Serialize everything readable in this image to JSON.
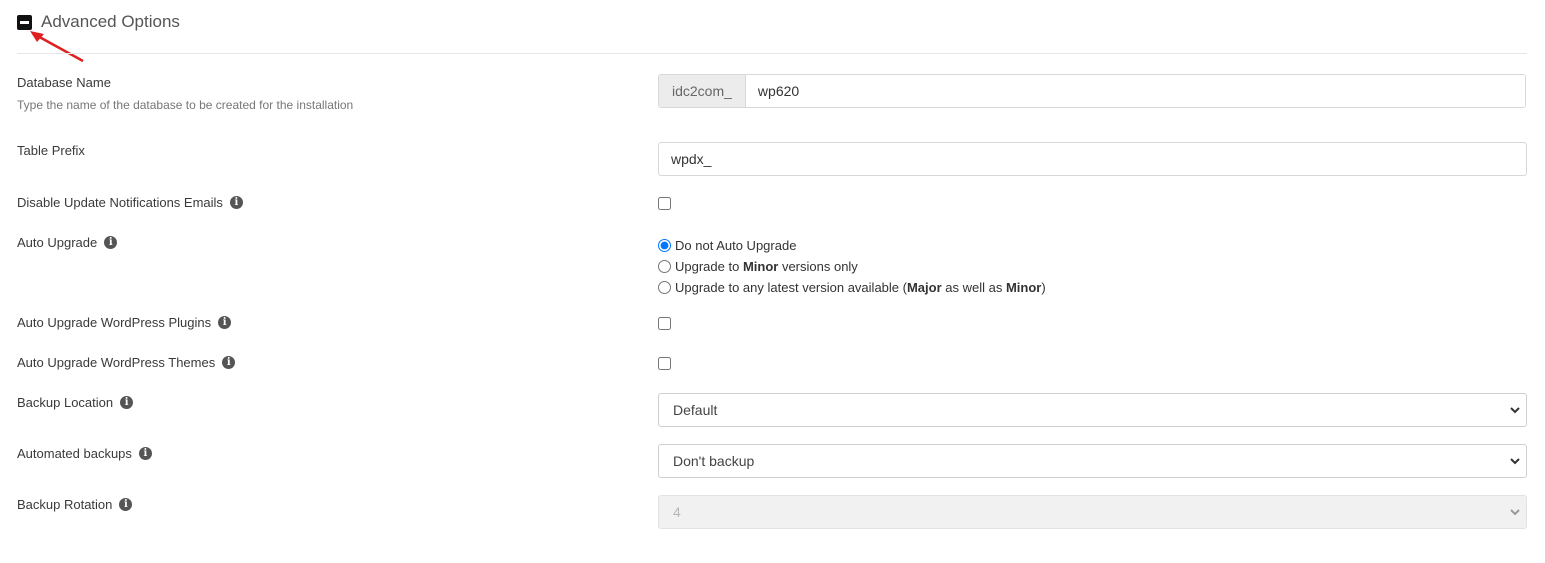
{
  "section": {
    "title": "Advanced Options",
    "toggle_icon": "minus-square-icon"
  },
  "fields": {
    "database_name": {
      "label": "Database Name",
      "help": "Type the name of the database to be created for the installation",
      "prefix": "idc2com_",
      "value": "wp620"
    },
    "table_prefix": {
      "label": "Table Prefix",
      "value": "wpdx_"
    },
    "disable_update_emails": {
      "label": "Disable Update Notifications Emails",
      "checked": false
    },
    "auto_upgrade": {
      "label": "Auto Upgrade",
      "options": {
        "none": "Do not Auto Upgrade",
        "minor_pre": "Upgrade to ",
        "minor_bold": "Minor",
        "minor_post": " versions only",
        "any_pre": "Upgrade to any latest version available (",
        "any_major": "Major",
        "any_mid": " as well as ",
        "any_minor": "Minor",
        "any_post": ")"
      },
      "selected": "none"
    },
    "auto_upgrade_plugins": {
      "label": "Auto Upgrade WordPress Plugins",
      "checked": false
    },
    "auto_upgrade_themes": {
      "label": "Auto Upgrade WordPress Themes",
      "checked": false
    },
    "backup_location": {
      "label": "Backup Location",
      "value": "Default"
    },
    "automated_backups": {
      "label": "Automated backups",
      "value": "Don't backup"
    },
    "backup_rotation": {
      "label": "Backup Rotation",
      "value": "4",
      "disabled": true
    }
  },
  "colors": {
    "arrow": "#e02020",
    "info_icon": "#555555"
  }
}
